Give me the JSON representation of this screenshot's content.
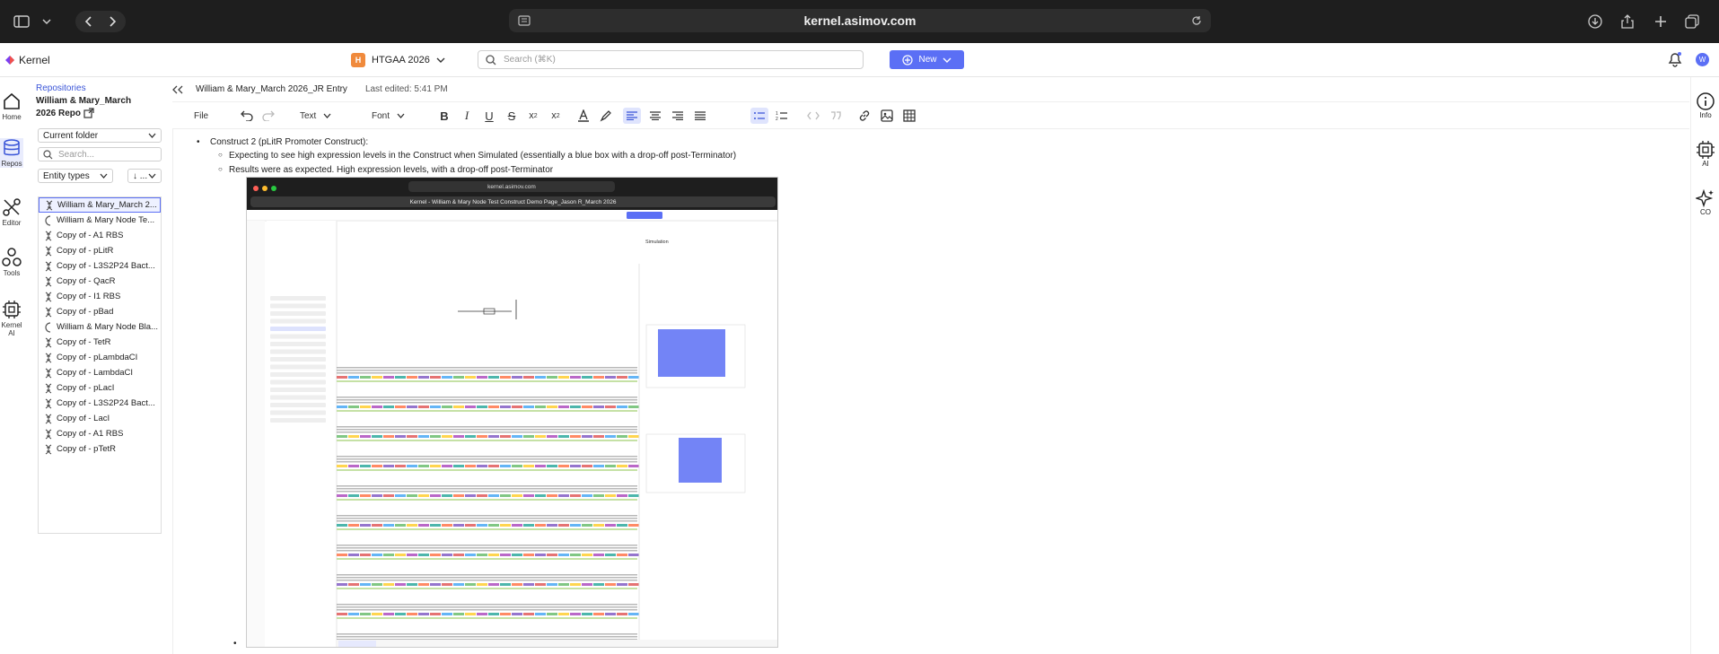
{
  "browser": {
    "url": "kernel.asimov.com"
  },
  "app": {
    "name": "Kernel",
    "user_initial": "W"
  },
  "project": {
    "badge": "H",
    "name": "HTGAA 2026"
  },
  "search": {
    "placeholder": "Search (⌘K)"
  },
  "new_button": "New",
  "left_nav": [
    {
      "label": "Home",
      "icon": "home-icon"
    },
    {
      "label": "Repos",
      "icon": "repos-icon"
    },
    {
      "label": "Editor",
      "icon": "editor-icon"
    },
    {
      "label": "Tools",
      "icon": "tools-icon"
    },
    {
      "label": "Kernel AI",
      "icon": "kernel-ai-icon"
    }
  ],
  "repos": {
    "breadcrumb": "Repositories",
    "title": "William & Mary_March 2026 Repo",
    "folder_select": "Current folder",
    "search_placeholder": "Search...",
    "filter_select": "Entity types",
    "sort_select": "↓ ...",
    "files": [
      "William & Mary_March 2...",
      "William & Mary Node Te...",
      "Copy of - A1 RBS",
      "Copy of - pLitR",
      "Copy of - L3S2P24 Bact...",
      "Copy of - QacR",
      "Copy of - I1 RBS",
      "Copy of - pBad",
      "William & Mary Node Bla...",
      "Copy of - TetR",
      "Copy of - pLambdaCI",
      "Copy of - LambdaCI",
      "Copy of - pLacI",
      "Copy of - L3S2P24 Bact...",
      "Copy of - LacI",
      "Copy of - A1 RBS",
      "Copy of - pTetR"
    ]
  },
  "editor": {
    "doc_title": "William & Mary_March 2026_JR Entry",
    "last_edited": "Last edited: 5:41 PM",
    "toolbar": {
      "file": "File",
      "text": "Text",
      "font": "Font"
    }
  },
  "content": {
    "bullet1": "Construct 2 (pLitR Promoter Construct):",
    "sub1": "Expecting to see high expression levels in the Construct when Simulated (essentially a blue box with a drop-off post-Terminator)",
    "sub2": "Results were as expected. High expression levels, with a drop-off post-Terminator"
  },
  "embedded": {
    "url": "kernel.asimov.com",
    "tab_title": "Kernel - William & Mary Node Test Construct Demo Page_Jason R_March 2026",
    "panel_title": "Simulation"
  },
  "right_nav": [
    {
      "label": "Info",
      "icon": "info-icon"
    },
    {
      "label": "AI",
      "icon": "ai-chip-icon"
    },
    {
      "label": "CO",
      "icon": "sparkle-icon"
    }
  ],
  "colors": {
    "accent": "#5b6ff5",
    "project_badge": "#f08a3c",
    "link": "#3a55d8"
  }
}
